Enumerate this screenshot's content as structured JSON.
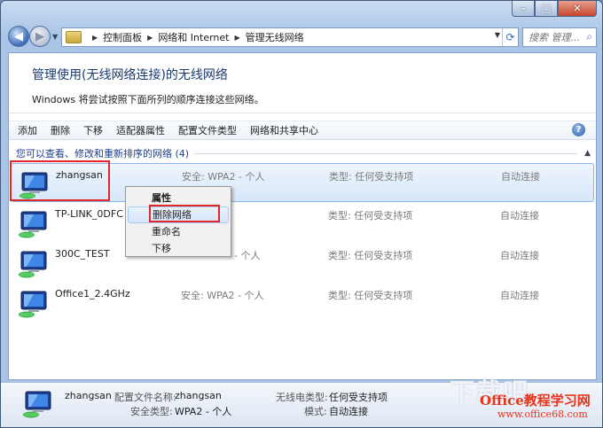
{
  "window": {
    "caption_buttons": [
      "–",
      "□",
      "✕"
    ]
  },
  "address_bar": {
    "crumbs": [
      "控制面板",
      "网络和 Internet",
      "管理无线网络"
    ],
    "search_placeholder": "搜索 管理..."
  },
  "header": {
    "title": "管理使用(无线网络连接)的无线网络",
    "subtitle": "Windows 将尝试按照下面所列的顺序连接这些网络。"
  },
  "toolbar": {
    "items": [
      "添加",
      "删除",
      "下移",
      "适配器属性",
      "配置文件类型",
      "网络和共享中心"
    ],
    "help": "?"
  },
  "group": {
    "label": "您可以查看、修改和重新排序的网络 (4)"
  },
  "networks": [
    {
      "name": "zhangsan",
      "security": "安全: WPA2 - 个人",
      "type": "类型: 任何受支持项",
      "mode": "自动连接"
    },
    {
      "name": "TP-LINK_0DFC",
      "security": "",
      "type": "类型: 任何受支持项",
      "mode": "自动连接"
    },
    {
      "name": "300C_TEST",
      "security": "- 个人",
      "type": "类型: 任何受支持项",
      "mode": "自动连接"
    },
    {
      "name": "Office1_2.4GHz",
      "security": "安全: WPA2 - 个人",
      "type": "类型: 任何受支持项",
      "mode": "自动连接"
    }
  ],
  "context_menu": {
    "items": [
      "属性",
      "删除网络",
      "重命名",
      "下移"
    ]
  },
  "details": {
    "name": "zhangsan",
    "profile_label": "配置文件名称:",
    "profile_value": "zhangsan",
    "security_label": "安全类型:",
    "security_value": "WPA2 - 个人",
    "radio_label": "无线电类型:",
    "radio_value": "任何受支持项",
    "mode_label": "模式:",
    "mode_value": "自动连接"
  },
  "watermark": {
    "big": "下载吧",
    "brand": "Office教程学习网",
    "url": "www.office68.com"
  },
  "colors": {
    "highlight_box": "#e4262c",
    "title": "#1a3a6c",
    "selection": "#d7e7fa"
  }
}
